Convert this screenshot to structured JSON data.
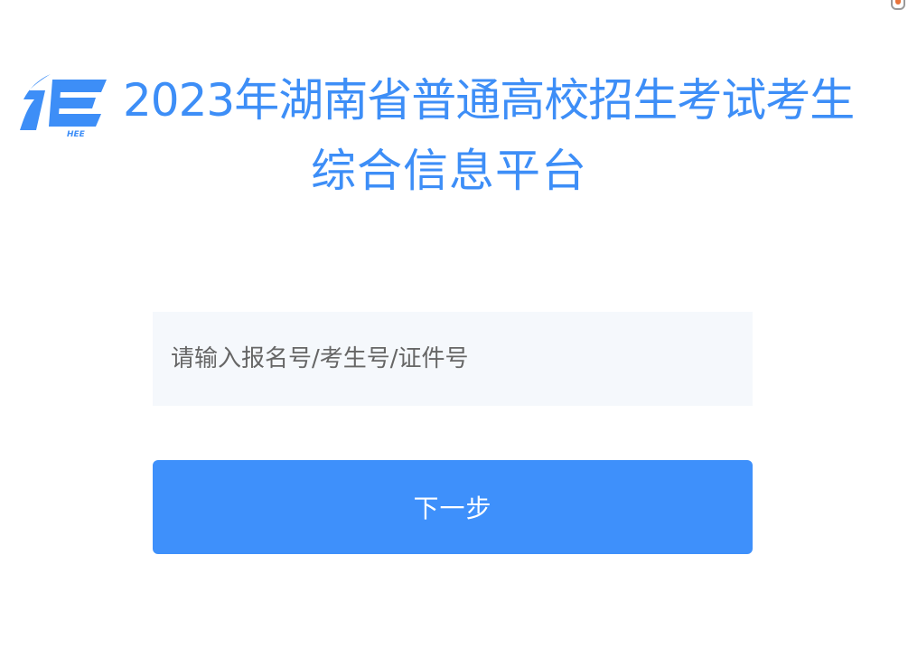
{
  "header": {
    "title_line1": "2023年湖南省普通高校招生考试考生",
    "title_line2": "综合信息平台",
    "logo_icon": "hee-logo-icon",
    "logo_text": "HEE"
  },
  "form": {
    "id_input": {
      "value": "",
      "placeholder": "请输入报名号/考生号/证件号"
    },
    "next_button_label": "下一步"
  },
  "colors": {
    "primary": "#3e90fb",
    "title": "#3d8ef7",
    "input_bg": "#f5f8fc"
  }
}
